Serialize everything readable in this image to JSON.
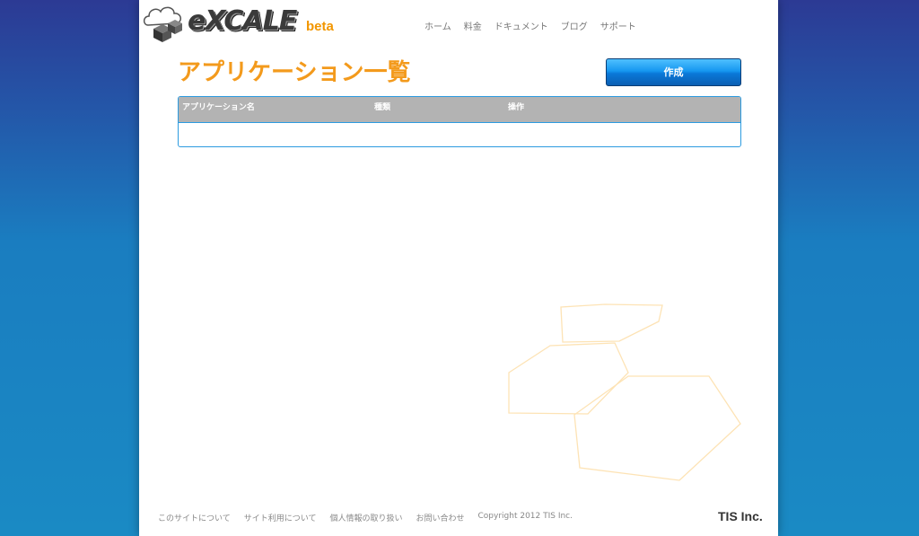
{
  "header": {
    "logo_text": "eXCALE",
    "logo_badge": "beta",
    "nav": [
      "ホーム",
      "料金",
      "ドキュメント",
      "ブログ",
      "サポート"
    ]
  },
  "main": {
    "title": "アプリケーション一覧",
    "create_label": "作成",
    "table": {
      "columns": [
        "アプリケーション名",
        "種類",
        "操作"
      ],
      "rows": []
    }
  },
  "footer": {
    "links": [
      "このサイトについて",
      "サイト利用について",
      "個人情報の取り扱い",
      "お問い合わせ"
    ],
    "copyright": "Copyright 2012 TIS Inc.",
    "company_logo": "TIS Inc."
  },
  "colors": {
    "accent_orange": "#f39a1c",
    "button_blue": "#1697f0",
    "table_header_gray": "#b3b3b3",
    "table_border_blue": "#2c9be0"
  }
}
